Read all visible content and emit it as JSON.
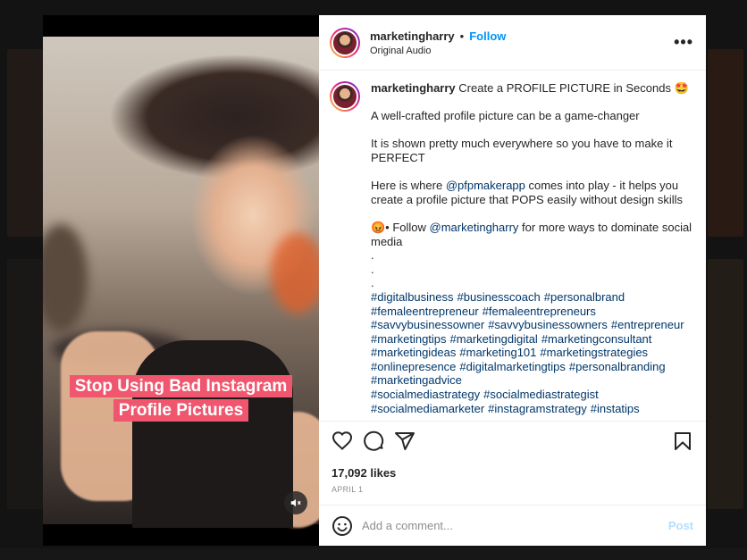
{
  "post": {
    "username": "marketingharry",
    "follow_label": "Follow",
    "audio_label": "Original Audio",
    "more_icon": "more-dots-icon",
    "overlay_text_line1": "Stop Using Bad Instagram",
    "overlay_text_line2": "Profile Pictures",
    "mute_icon": "muted-speaker-icon"
  },
  "caption": {
    "username": "marketingharry",
    "title": "Create a PROFILE PICTURE in Seconds 🤩",
    "p1": "A well-crafted profile picture can be a game-changer",
    "p2": "It is shown pretty much everywhere so you have to make it PERFECT",
    "p3_before": "Here is where ",
    "p3_mention": "@pfpmakerapp",
    "p3_after": " comes into play - it helps you create a profile picture that POPS easily without design skills",
    "p4_prefix": "😡• Follow ",
    "p4_mention": "@marketingharry",
    "p4_after": " for more ways to dominate social media",
    "dots": [
      ".",
      ".",
      "."
    ],
    "hashtags": [
      "#digitalbusiness",
      "#businesscoach",
      "#personalbrand",
      "#femaleentrepreneur",
      "#femaleentrepreneurs",
      "#savvybusinessowner",
      "#savvybusinessowners",
      "#entrepreneur",
      "#marketingtips",
      "#marketingdigital",
      "#marketingconsultant",
      "#marketingideas",
      "#marketing101",
      "#marketingstrategies",
      "#onlinepresence",
      "#digitalmarketingtips",
      "#personalbranding",
      "#marketingadvice",
      "#socialmediastrategy",
      "#socialmediastrategist",
      "#socialmediamarketer",
      "#instagramstrategy",
      "#instatips"
    ]
  },
  "actions": {
    "like_icon": "heart-icon",
    "comment_icon": "comment-bubble-icon",
    "share_icon": "paper-plane-icon",
    "save_icon": "bookmark-icon"
  },
  "stats": {
    "likes": "17,092 likes",
    "date": "APRIL 1"
  },
  "comment_box": {
    "emoji_icon": "smiley-icon",
    "placeholder": "Add a comment...",
    "post_label": "Post"
  },
  "colors": {
    "accent": "#0095f6",
    "mention": "#00376b",
    "banner": "#f0566e",
    "post_disabled": "#b2dffc"
  }
}
